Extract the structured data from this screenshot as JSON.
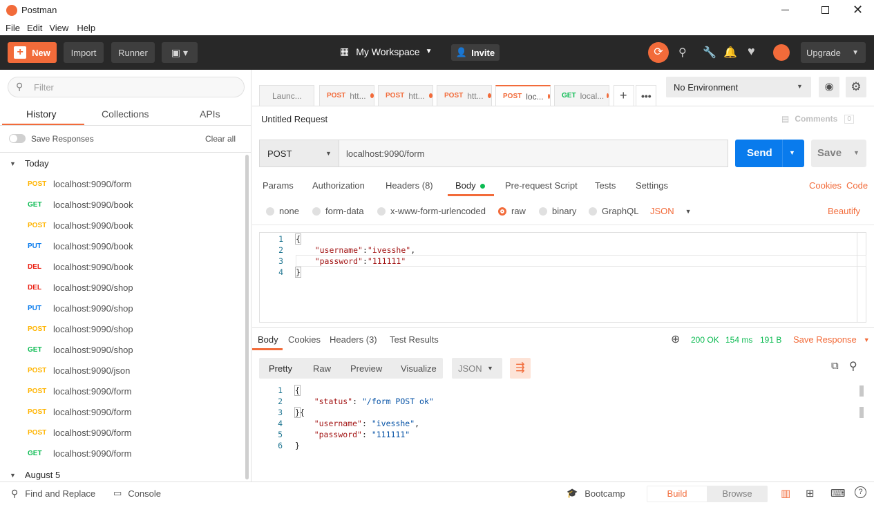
{
  "window": {
    "title": "Postman"
  },
  "menu": [
    "File",
    "Edit",
    "View",
    "Help"
  ],
  "header": {
    "new_label": "New",
    "import_label": "Import",
    "runner_label": "Runner",
    "workspace_label": "My Workspace",
    "invite_label": "Invite",
    "upgrade_label": "Upgrade"
  },
  "sidebar": {
    "filter_placeholder": "Filter",
    "tabs": [
      "History",
      "Collections",
      "APIs"
    ],
    "save_responses_label": "Save Responses",
    "clear_all_label": "Clear all",
    "group_today": "Today",
    "group_aug5": "August 5",
    "history": [
      {
        "method": "POST",
        "url": "localhost:9090/form"
      },
      {
        "method": "GET",
        "url": "localhost:9090/book"
      },
      {
        "method": "POST",
        "url": "localhost:9090/book"
      },
      {
        "method": "PUT",
        "url": "localhost:9090/book"
      },
      {
        "method": "DEL",
        "url": "localhost:9090/book"
      },
      {
        "method": "DEL",
        "url": "localhost:9090/shop"
      },
      {
        "method": "PUT",
        "url": "localhost:9090/shop"
      },
      {
        "method": "POST",
        "url": "localhost:9090/shop"
      },
      {
        "method": "GET",
        "url": "localhost:9090/shop"
      },
      {
        "method": "POST",
        "url": "localhost:9090/json"
      },
      {
        "method": "POST",
        "url": "localhost:9090/form"
      },
      {
        "method": "POST",
        "url": "localhost:9090/form"
      },
      {
        "method": "POST",
        "url": "localhost:9090/form"
      },
      {
        "method": "GET",
        "url": "localhost:9090/form"
      }
    ]
  },
  "tabs": [
    {
      "method": "",
      "label": "Launc..."
    },
    {
      "method": "POST",
      "label": "htt..."
    },
    {
      "method": "POST",
      "label": "htt..."
    },
    {
      "method": "POST",
      "label": "htt..."
    },
    {
      "method": "POST",
      "label": "loc..."
    },
    {
      "method": "GET",
      "label": "local..."
    }
  ],
  "environment": {
    "selected": "No Environment"
  },
  "request": {
    "title": "Untitled Request",
    "comments_label": "Comments",
    "comments_count": "0",
    "method": "POST",
    "url": "localhost:9090/form",
    "send_label": "Send",
    "save_label": "Save",
    "subtabs": [
      "Params",
      "Authorization",
      "Headers (8)",
      "Body",
      "Pre-request Script",
      "Tests",
      "Settings"
    ],
    "cookies_label": "Cookies",
    "code_label": "Code",
    "body_types": [
      "none",
      "form-data",
      "x-www-form-urlencoded",
      "raw",
      "binary",
      "GraphQL"
    ],
    "body_format": "JSON",
    "beautify_label": "Beautify",
    "body_lines": [
      [
        "",
        "{"
      ],
      [
        "    ",
        "\"username\"",
        ":",
        "\"ivesshe\"",
        ","
      ],
      [
        "    ",
        "\"password\"",
        ":",
        "\"111111\"",
        ""
      ],
      [
        "",
        "}"
      ]
    ],
    "line_numbers": [
      "1",
      "2",
      "3",
      "4"
    ]
  },
  "response": {
    "tabs": [
      "Body",
      "Cookies",
      "Headers (3)",
      "Test Results"
    ],
    "status": "200 OK",
    "time": "154 ms",
    "size": "191 B",
    "save_label": "Save Response",
    "view_modes": [
      "Pretty",
      "Raw",
      "Preview",
      "Visualize"
    ],
    "format": "JSON",
    "line_numbers": [
      "1",
      "2",
      "3",
      "4",
      "5",
      "6"
    ],
    "lines": {
      "l2_key": "\"status\"",
      "l2_val": "\"/form POST ok\"",
      "l4_key": "\"username\"",
      "l4_val": "\"ivesshe\"",
      "l5_key": "\"password\"",
      "l5_val": "\"111111\""
    }
  },
  "footer": {
    "find_replace": "Find and Replace",
    "console": "Console",
    "bootcamp": "Bootcamp",
    "build": "Build",
    "browse": "Browse"
  },
  "colors": {
    "accent": "#f26b3a",
    "send": "#097bed",
    "get": "#0cbb52",
    "post": "#ffb400",
    "put": "#097bed",
    "del": "#eb2013",
    "header": "#282828"
  }
}
